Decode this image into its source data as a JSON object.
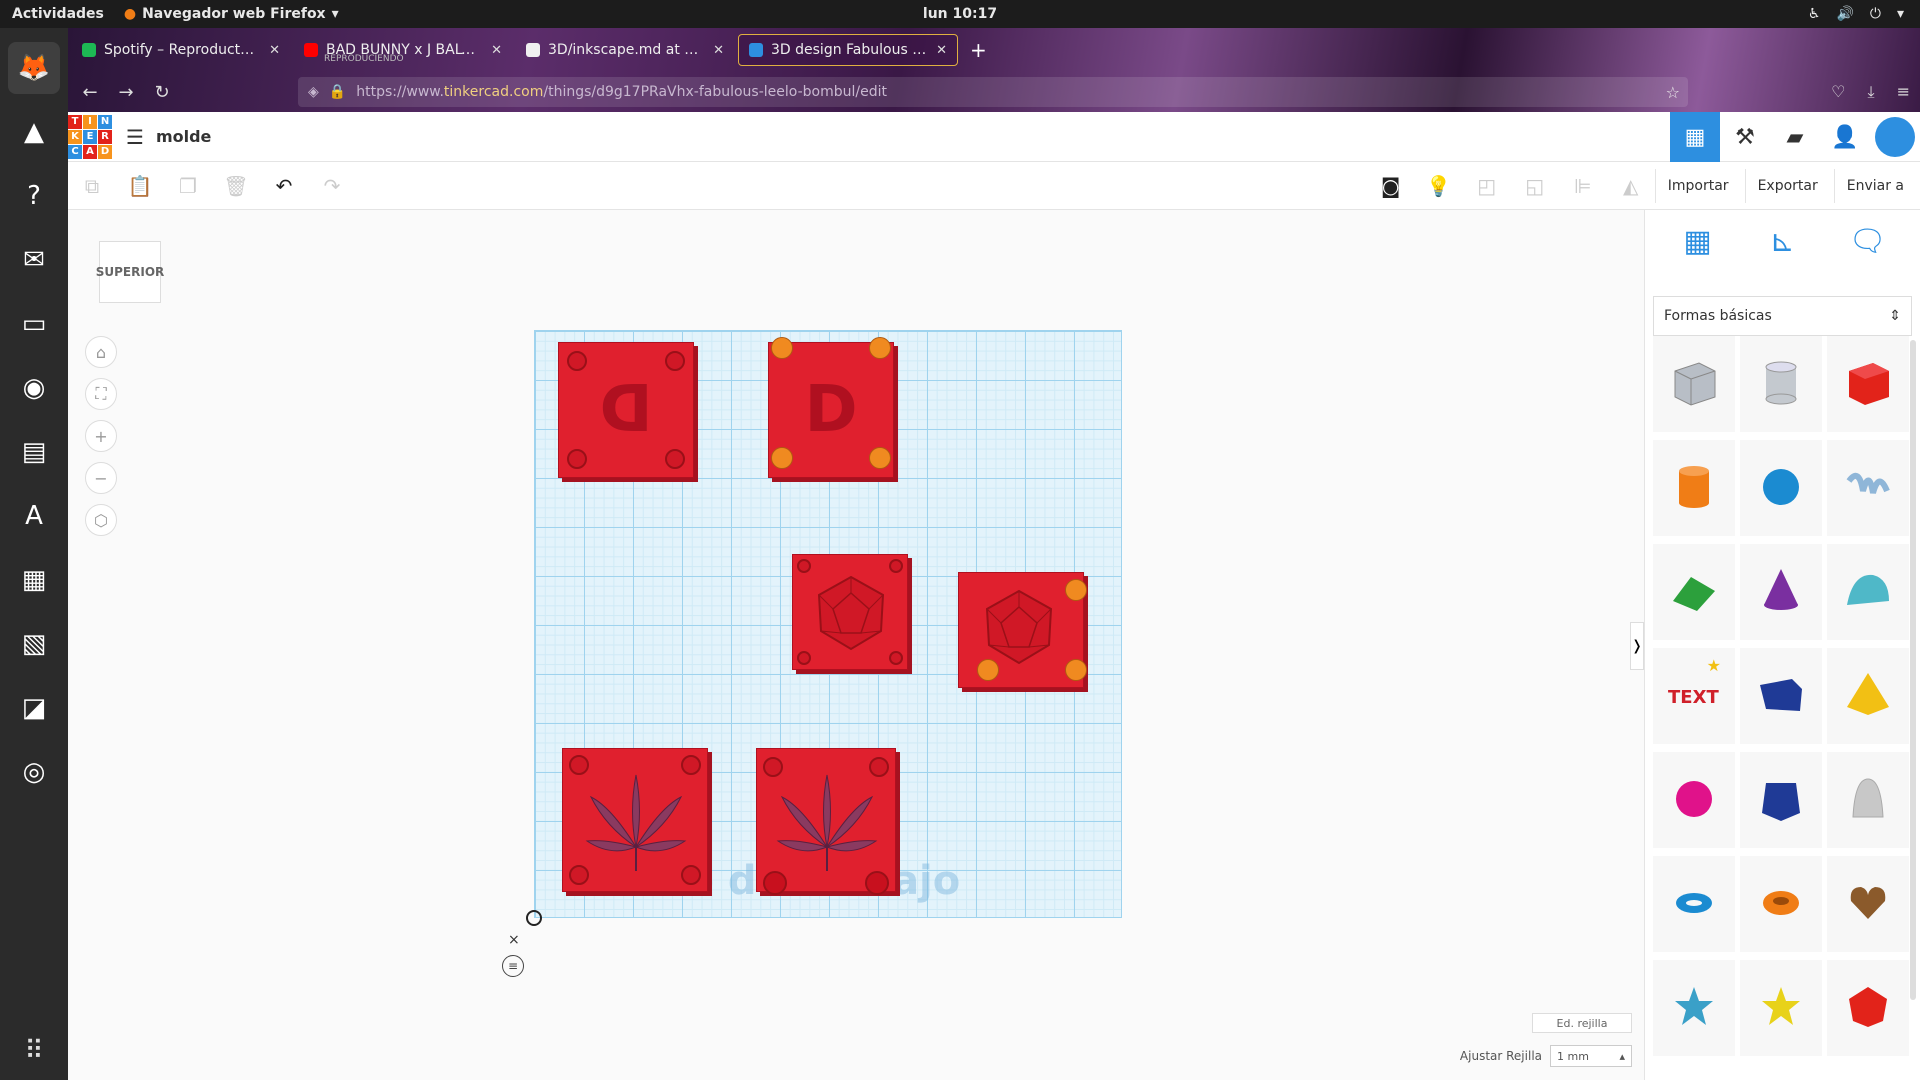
{
  "os_topbar": {
    "activities": "Actividades",
    "app_name": "Navegador web Firefox",
    "clock": "lun 10:17"
  },
  "dock_items": [
    {
      "name": "firefox-icon",
      "glyph": "🦊"
    },
    {
      "name": "inkscape-icon",
      "glyph": "▲"
    },
    {
      "name": "help-icon",
      "glyph": "?"
    },
    {
      "name": "thunderbird-icon",
      "glyph": "✉"
    },
    {
      "name": "files-icon",
      "glyph": "▭"
    },
    {
      "name": "rhythmbox-icon",
      "glyph": "◉"
    },
    {
      "name": "writer-icon",
      "glyph": "▤"
    },
    {
      "name": "software-icon",
      "glyph": "A"
    },
    {
      "name": "calculator-icon",
      "glyph": "▦"
    },
    {
      "name": "impress-icon",
      "glyph": "▧"
    },
    {
      "name": "image-viewer-icon",
      "glyph": "◪"
    },
    {
      "name": "blender-icon",
      "glyph": "◎"
    }
  ],
  "browser": {
    "tabs": [
      {
        "label": "Spotify – Reproductor w",
        "subtitle": "",
        "favicon_color": "#1db954",
        "selected": false
      },
      {
        "label": "BAD BUNNY x J BALVIN",
        "subtitle": "REPRODUCIENDO",
        "favicon_color": "#ff0000",
        "selected": false
      },
      {
        "label": "3D/inkscape.md at main",
        "subtitle": "",
        "favicon_color": "#f0f0f0",
        "selected": false
      },
      {
        "label": "3D design Fabulous Leelo",
        "subtitle": "",
        "favicon_color": "#2d8fe0",
        "selected": true
      }
    ],
    "url_prefix": "https://www.",
    "url_domain": "tinkercad.com",
    "url_path": "/things/d9g17PRaVhx-fabulous-leelo-bombul/edit"
  },
  "tinkercad": {
    "logo_letters": [
      "T",
      "I",
      "N",
      "K",
      "E",
      "R",
      "C",
      "A",
      "D"
    ],
    "logo_colors": [
      "#e2231a",
      "#f7941d",
      "#2d8fe0",
      "#f7941d",
      "#2d8fe0",
      "#e2231a",
      "#2d8fe0",
      "#e2231a",
      "#f7941d"
    ],
    "design_title": "molde",
    "import_label": "Importar",
    "export_label": "Exportar",
    "send_label": "Enviar a",
    "viewcube_label": "SUPERIOR",
    "workplane_label": "Plano de trabajo",
    "edit_grid_label": "Ed. rejilla",
    "snap_grid_label": "Ajustar Rejilla",
    "snap_grid_value": "1 mm",
    "shape_category": "Formas básicas",
    "shapes": [
      {
        "name": "box-hole",
        "color": "#b8bec6"
      },
      {
        "name": "cylinder-hole",
        "color": "#c4c9cf"
      },
      {
        "name": "box",
        "color": "#e2231a"
      },
      {
        "name": "cylinder",
        "color": "#f07d16"
      },
      {
        "name": "sphere",
        "color": "#1b8bd1"
      },
      {
        "name": "scribble",
        "color": "#8fb6d8"
      },
      {
        "name": "roof",
        "color": "#2ca03c"
      },
      {
        "name": "cone",
        "color": "#7a2fa0"
      },
      {
        "name": "round-roof",
        "color": "#4fb8c8"
      },
      {
        "name": "text",
        "color": "#d0202a"
      },
      {
        "name": "wedge",
        "color": "#1f3a96"
      },
      {
        "name": "pyramid",
        "color": "#f2c014"
      },
      {
        "name": "half-sphere",
        "color": "#e0128a"
      },
      {
        "name": "polygon",
        "color": "#1f3a96"
      },
      {
        "name": "paraboloid",
        "color": "#c8c8c8"
      },
      {
        "name": "torus",
        "color": "#1b8bd1"
      },
      {
        "name": "tube",
        "color": "#f07d16"
      },
      {
        "name": "heart",
        "color": "#8b5a2b"
      },
      {
        "name": "star",
        "color": "#3aa0c8"
      },
      {
        "name": "star-yellow",
        "color": "#e8d21a"
      },
      {
        "name": "icosahedron",
        "color": "#e2231a"
      }
    ],
    "text_shape_label": "TEXT"
  }
}
